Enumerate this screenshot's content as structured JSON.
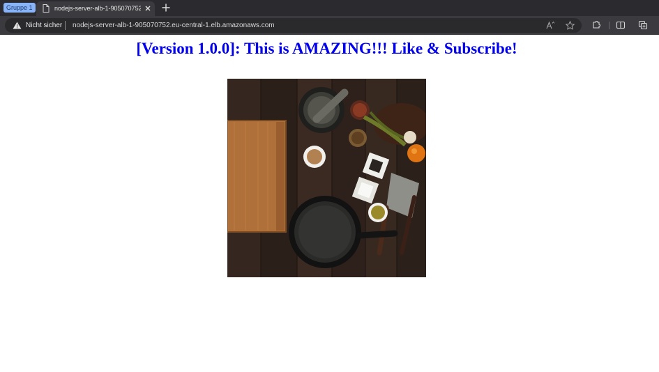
{
  "browser": {
    "tab_group_label": "Gruppe 1",
    "tab_title": "nodejs-server-alb-1-905070752.eu-central-1.elb.amazonaws.com",
    "security_label": "Nicht sicher",
    "url": "nodejs-server-alb-1-905070752.eu-central-1.elb.amazonaws.com",
    "icons": [
      "page-icon",
      "close-icon",
      "plus-icon",
      "warning-icon",
      "read-aloud-icon",
      "favorite-star-icon",
      "extensions-icon",
      "split-screen-icon",
      "collections-icon"
    ]
  },
  "page": {
    "heading": "[Version 1.0.0]: This is AMAZING!!! Like & Subscribe!",
    "image": "kitchen-photo"
  },
  "colors": {
    "heading": "#0000ee",
    "tab_group": "#8ab4f8",
    "chrome_dark": "#2b2b2f"
  }
}
